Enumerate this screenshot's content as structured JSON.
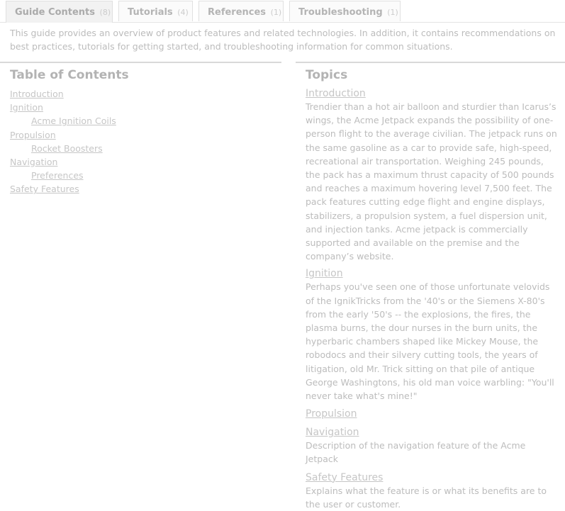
{
  "tabs": [
    {
      "label": "Guide Contents",
      "count": "(8)",
      "active": true
    },
    {
      "label": "Tutorials",
      "count": "(4)",
      "active": false
    },
    {
      "label": "References",
      "count": "(1)",
      "active": false
    },
    {
      "label": "Troubleshooting",
      "count": "(1)",
      "active": false
    }
  ],
  "intro": "This guide provides an overview of product features and related technologies. In addition, it contains recommendations on best practices, tutorials for getting started, and troubleshooting information for common situations.",
  "toc": {
    "title": "Table of Contents",
    "items": [
      {
        "label": "Introduction",
        "level": 1
      },
      {
        "label": "Ignition",
        "level": 1
      },
      {
        "label": "Acme Ignition Coils",
        "level": 2
      },
      {
        "label": "Propulsion",
        "level": 1
      },
      {
        "label": "Rocket Boosters",
        "level": 2
      },
      {
        "label": "Navigation",
        "level": 1
      },
      {
        "label": "Preferences",
        "level": 2
      },
      {
        "label": "Safety Features",
        "level": 1
      }
    ]
  },
  "topics": {
    "title": "Topics",
    "items": [
      {
        "title": "Introduction",
        "body": "Trendier than a hot air balloon and sturdier than Icarus’s wings, the Acme Jetpack expands the possibility of one-person flight to the average civilian.  The jetpack runs on the same gasoline as a car to provide safe, high-speed, recreational air transportation.  Weighing 245 pounds, the pack has a maximum thrust capacity of 500 pounds and reaches a maximum hovering level 7,500 feet.  The pack features cutting edge flight and engine displays, stabilizers, a propulsion system, a fuel dispersion unit, and injection tanks.   Acme jetpack is commercially supported and available on the premise and the company’s website."
      },
      {
        "title": "Ignition",
        "body": "Perhaps you've seen one of those unfortunate velovids of the IgnikTricks from the '40's or the Siemens X-80's from the early '50's -- the explosions, the fires, the plasma burns, the dour nurses in the burn units, the hyperbaric chambers shaped like Mickey Mouse, the robodocs and their silvery cutting tools, the years of litigation, old Mr. Trick sitting on that pile of antique George Washingtons, his old man voice warbling: \"You'll never take what's mine!\""
      },
      {
        "title": "Propulsion",
        "body": ""
      },
      {
        "title": "Navigation",
        "body": "Description of the navigation feature of the Acme Jetpack"
      },
      {
        "title": "Safety Features",
        "body": "Explains what the feature is or what its benefits are to the user or customer."
      }
    ]
  }
}
